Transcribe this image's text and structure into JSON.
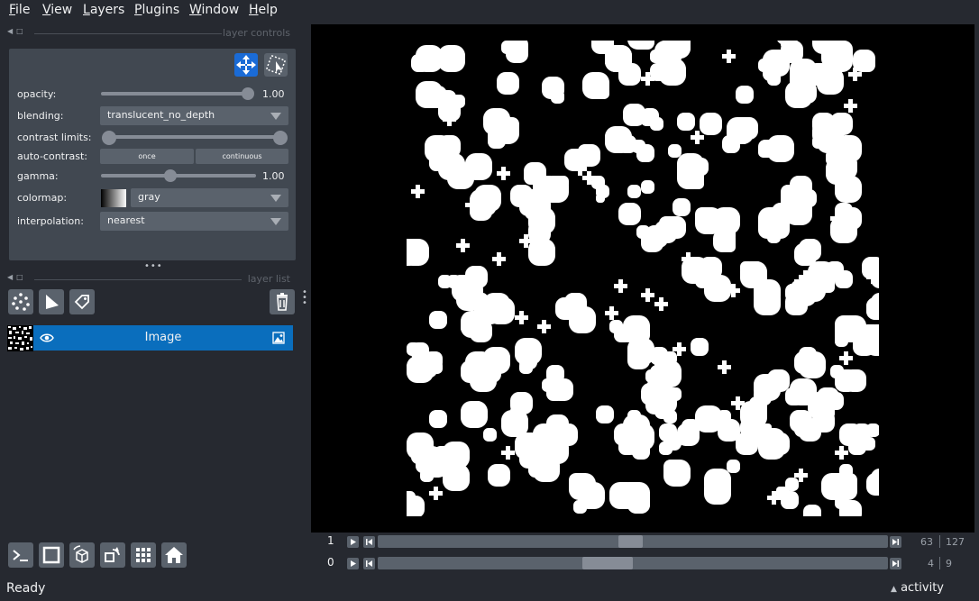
{
  "menubar": {
    "items": [
      {
        "pre": "",
        "key": "F",
        "rest": "ile"
      },
      {
        "pre": "",
        "key": "V",
        "rest": "iew"
      },
      {
        "pre": "",
        "key": "L",
        "rest": "ayers"
      },
      {
        "pre": "",
        "key": "P",
        "rest": "lugins"
      },
      {
        "pre": "",
        "key": "W",
        "rest": "indow"
      },
      {
        "pre": "",
        "key": "H",
        "rest": "elp"
      }
    ]
  },
  "layer_controls": {
    "title": "layer controls",
    "opacity": {
      "label": "opacity:",
      "value": "1.00",
      "fraction": 1.0
    },
    "blending": {
      "label": "blending:",
      "value": "translucent_no_depth"
    },
    "contrast_limits": {
      "label": "contrast limits:",
      "low_fraction": 0.0,
      "high_fraction": 1.0
    },
    "auto_contrast": {
      "label": "auto-contrast:",
      "once": "once",
      "continuous": "continuous"
    },
    "gamma": {
      "label": "gamma:",
      "value": "1.00"
    },
    "colormap": {
      "label": "colormap:",
      "value": "gray"
    },
    "interpolation": {
      "label": "interpolation:",
      "value": "nearest"
    }
  },
  "layer_list": {
    "title": "layer list",
    "layers": [
      {
        "name": "Image",
        "visible": true,
        "selected": true
      }
    ]
  },
  "dims": [
    {
      "index": "1",
      "current": "63",
      "total": "127"
    },
    {
      "index": "0",
      "current": "4",
      "total": "9"
    }
  ],
  "status": {
    "text": "Ready",
    "activity": "activity"
  },
  "colors": {
    "accent": "#1a6bd6",
    "selected_layer": "#0a6ebd",
    "background": "#262930",
    "panel": "#414851"
  },
  "icons": {
    "viewer_buttons": [
      "console-icon",
      "ndisplay-square-icon",
      "roll-3d-icon",
      "transpose-icon",
      "grid-icon",
      "home-icon"
    ],
    "layer_tools": [
      "new-points-icon",
      "new-shapes-icon",
      "new-labels-icon",
      "delete-layer-icon"
    ]
  }
}
